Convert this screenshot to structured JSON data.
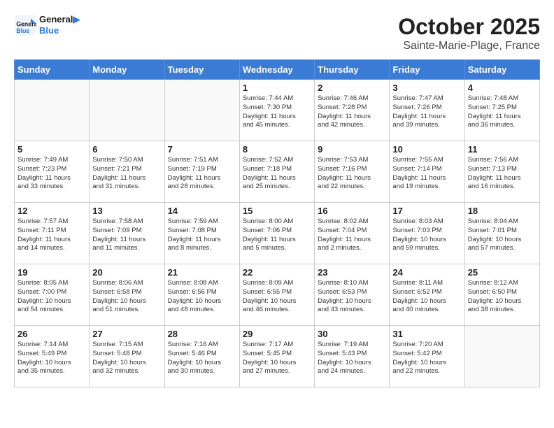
{
  "header": {
    "logo_line1": "General",
    "logo_line2": "Blue",
    "month_title": "October 2025",
    "subtitle": "Sainte-Marie-Plage, France"
  },
  "weekdays": [
    "Sunday",
    "Monday",
    "Tuesday",
    "Wednesday",
    "Thursday",
    "Friday",
    "Saturday"
  ],
  "weeks": [
    [
      {
        "day": "",
        "text": ""
      },
      {
        "day": "",
        "text": ""
      },
      {
        "day": "",
        "text": ""
      },
      {
        "day": "1",
        "text": "Sunrise: 7:44 AM\nSunset: 7:30 PM\nDaylight: 11 hours\nand 45 minutes."
      },
      {
        "day": "2",
        "text": "Sunrise: 7:46 AM\nSunset: 7:28 PM\nDaylight: 11 hours\nand 42 minutes."
      },
      {
        "day": "3",
        "text": "Sunrise: 7:47 AM\nSunset: 7:26 PM\nDaylight: 11 hours\nand 39 minutes."
      },
      {
        "day": "4",
        "text": "Sunrise: 7:48 AM\nSunset: 7:25 PM\nDaylight: 11 hours\nand 36 minutes."
      }
    ],
    [
      {
        "day": "5",
        "text": "Sunrise: 7:49 AM\nSunset: 7:23 PM\nDaylight: 11 hours\nand 33 minutes."
      },
      {
        "day": "6",
        "text": "Sunrise: 7:50 AM\nSunset: 7:21 PM\nDaylight: 11 hours\nand 31 minutes."
      },
      {
        "day": "7",
        "text": "Sunrise: 7:51 AM\nSunset: 7:19 PM\nDaylight: 11 hours\nand 28 minutes."
      },
      {
        "day": "8",
        "text": "Sunrise: 7:52 AM\nSunset: 7:18 PM\nDaylight: 11 hours\nand 25 minutes."
      },
      {
        "day": "9",
        "text": "Sunrise: 7:53 AM\nSunset: 7:16 PM\nDaylight: 11 hours\nand 22 minutes."
      },
      {
        "day": "10",
        "text": "Sunrise: 7:55 AM\nSunset: 7:14 PM\nDaylight: 11 hours\nand 19 minutes."
      },
      {
        "day": "11",
        "text": "Sunrise: 7:56 AM\nSunset: 7:13 PM\nDaylight: 11 hours\nand 16 minutes."
      }
    ],
    [
      {
        "day": "12",
        "text": "Sunrise: 7:57 AM\nSunset: 7:11 PM\nDaylight: 11 hours\nand 14 minutes."
      },
      {
        "day": "13",
        "text": "Sunrise: 7:58 AM\nSunset: 7:09 PM\nDaylight: 11 hours\nand 11 minutes."
      },
      {
        "day": "14",
        "text": "Sunrise: 7:59 AM\nSunset: 7:08 PM\nDaylight: 11 hours\nand 8 minutes."
      },
      {
        "day": "15",
        "text": "Sunrise: 8:00 AM\nSunset: 7:06 PM\nDaylight: 11 hours\nand 5 minutes."
      },
      {
        "day": "16",
        "text": "Sunrise: 8:02 AM\nSunset: 7:04 PM\nDaylight: 11 hours\nand 2 minutes."
      },
      {
        "day": "17",
        "text": "Sunrise: 8:03 AM\nSunset: 7:03 PM\nDaylight: 10 hours\nand 59 minutes."
      },
      {
        "day": "18",
        "text": "Sunrise: 8:04 AM\nSunset: 7:01 PM\nDaylight: 10 hours\nand 57 minutes."
      }
    ],
    [
      {
        "day": "19",
        "text": "Sunrise: 8:05 AM\nSunset: 7:00 PM\nDaylight: 10 hours\nand 54 minutes."
      },
      {
        "day": "20",
        "text": "Sunrise: 8:06 AM\nSunset: 6:58 PM\nDaylight: 10 hours\nand 51 minutes."
      },
      {
        "day": "21",
        "text": "Sunrise: 8:08 AM\nSunset: 6:56 PM\nDaylight: 10 hours\nand 48 minutes."
      },
      {
        "day": "22",
        "text": "Sunrise: 8:09 AM\nSunset: 6:55 PM\nDaylight: 10 hours\nand 46 minutes."
      },
      {
        "day": "23",
        "text": "Sunrise: 8:10 AM\nSunset: 6:53 PM\nDaylight: 10 hours\nand 43 minutes."
      },
      {
        "day": "24",
        "text": "Sunrise: 8:11 AM\nSunset: 6:52 PM\nDaylight: 10 hours\nand 40 minutes."
      },
      {
        "day": "25",
        "text": "Sunrise: 8:12 AM\nSunset: 6:50 PM\nDaylight: 10 hours\nand 38 minutes."
      }
    ],
    [
      {
        "day": "26",
        "text": "Sunrise: 7:14 AM\nSunset: 5:49 PM\nDaylight: 10 hours\nand 35 minutes."
      },
      {
        "day": "27",
        "text": "Sunrise: 7:15 AM\nSunset: 5:48 PM\nDaylight: 10 hours\nand 32 minutes."
      },
      {
        "day": "28",
        "text": "Sunrise: 7:16 AM\nSunset: 5:46 PM\nDaylight: 10 hours\nand 30 minutes."
      },
      {
        "day": "29",
        "text": "Sunrise: 7:17 AM\nSunset: 5:45 PM\nDaylight: 10 hours\nand 27 minutes."
      },
      {
        "day": "30",
        "text": "Sunrise: 7:19 AM\nSunset: 5:43 PM\nDaylight: 10 hours\nand 24 minutes."
      },
      {
        "day": "31",
        "text": "Sunrise: 7:20 AM\nSunset: 5:42 PM\nDaylight: 10 hours\nand 22 minutes."
      },
      {
        "day": "",
        "text": ""
      }
    ]
  ]
}
